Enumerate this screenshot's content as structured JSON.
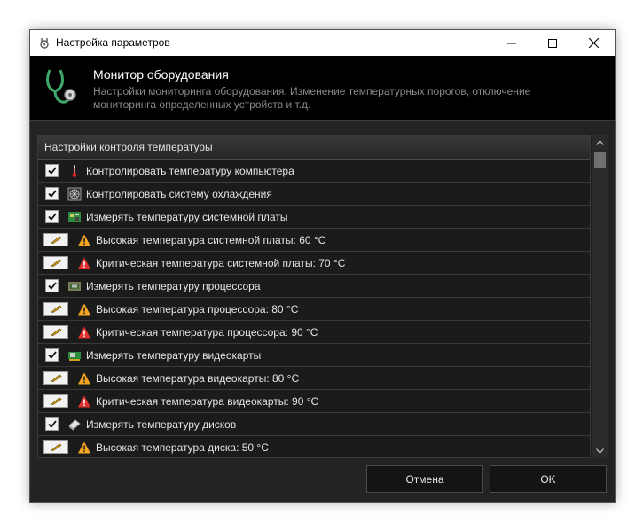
{
  "window": {
    "title": "Настройка параметров"
  },
  "header": {
    "title": "Монитор оборудования",
    "description": "Настройки мониторинга оборудования. Изменение температурных порогов, отключение мониторинга определенных устройств и т.д."
  },
  "list": {
    "header": "Настройки контроля температуры",
    "items": [
      {
        "kind": "checkbox",
        "checked": true,
        "icon": "thermometer-icon",
        "label": "Контролировать температуру компьютера"
      },
      {
        "kind": "checkbox",
        "checked": true,
        "icon": "fan-icon",
        "label": "Контролировать систему охлаждения"
      },
      {
        "kind": "checkbox",
        "checked": true,
        "icon": "motherboard-icon",
        "label": "Измерять температуру системной платы"
      },
      {
        "kind": "edit",
        "icon": "warning-orange-icon",
        "label": "Высокая температура системной платы: 60 °C"
      },
      {
        "kind": "edit",
        "icon": "warning-red-icon",
        "label": "Критическая температура системной платы: 70 °C"
      },
      {
        "kind": "checkbox",
        "checked": true,
        "icon": "cpu-icon",
        "label": "Измерять температуру процессора"
      },
      {
        "kind": "edit",
        "icon": "warning-orange-icon",
        "label": "Высокая температура процессора: 80 °C"
      },
      {
        "kind": "edit",
        "icon": "warning-red-icon",
        "label": "Критическая температура процессора: 90 °C"
      },
      {
        "kind": "checkbox",
        "checked": true,
        "icon": "gpu-icon",
        "label": "Измерять температуру видеокарты"
      },
      {
        "kind": "edit",
        "icon": "warning-orange-icon",
        "label": "Высокая температура видеокарты: 80 °C"
      },
      {
        "kind": "edit",
        "icon": "warning-red-icon",
        "label": "Критическая температура видеокарты: 90 °C"
      },
      {
        "kind": "checkbox",
        "checked": true,
        "icon": "disk-icon",
        "label": "Измерять температуру дисков"
      },
      {
        "kind": "edit",
        "icon": "warning-orange-icon",
        "label": "Высокая температура диска: 50 °C"
      }
    ]
  },
  "buttons": {
    "cancel": "Отмена",
    "ok": "OK"
  },
  "colors": {
    "warning_orange": "#f5a623",
    "warning_red": "#e03030",
    "background": "#232323",
    "header": "#000000"
  }
}
